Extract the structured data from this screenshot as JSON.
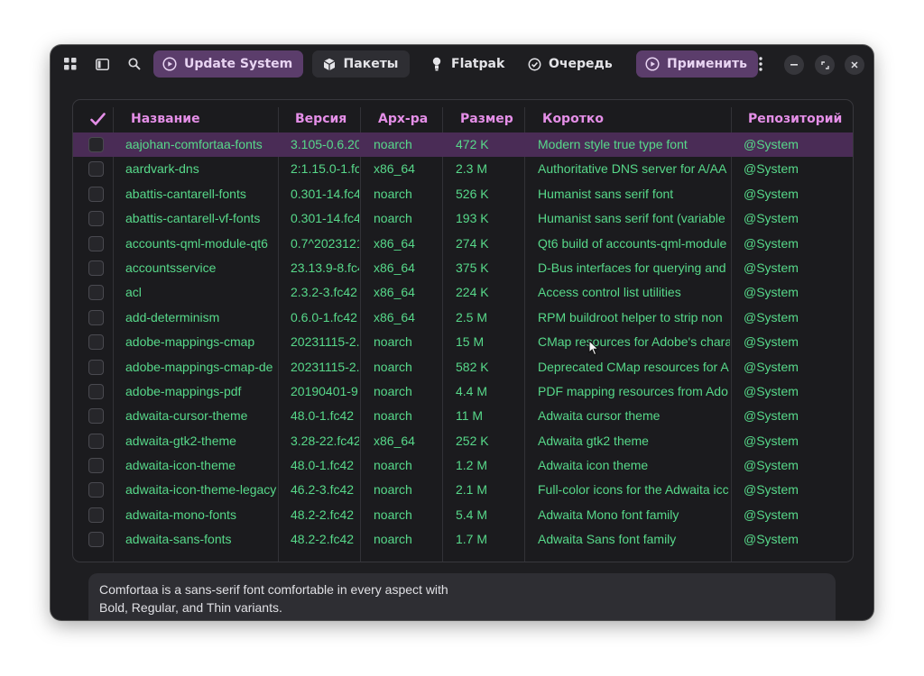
{
  "header": {
    "update_label": "Update System",
    "tabs": [
      {
        "label": "Пакеты",
        "icon": "package-icon",
        "active": true
      },
      {
        "label": "Flatpak",
        "icon": "flatpak-icon",
        "active": false
      },
      {
        "label": "Очередь",
        "icon": "check-circle-icon",
        "active": false
      }
    ],
    "apply_label": "Применить"
  },
  "table": {
    "columns": [
      "Название",
      "Версия",
      "Арх-ра",
      "Размер",
      "Коротко",
      "Репозиторий"
    ],
    "rows": [
      {
        "name": "aajohan-comfortaa-fonts",
        "version": "3.105-0.6.20",
        "arch": "noarch",
        "size": "472 K",
        "summary": "Modern style true type font",
        "repo": "@System",
        "selected": true
      },
      {
        "name": "aardvark-dns",
        "version": "2:1.15.0-1.fc",
        "arch": "x86_64",
        "size": "2.3 M",
        "summary": "Authoritative DNS server for A/AA",
        "repo": "@System"
      },
      {
        "name": "abattis-cantarell-fonts",
        "version": "0.301-14.fc4",
        "arch": "noarch",
        "size": "526 K",
        "summary": "Humanist sans serif font",
        "repo": "@System"
      },
      {
        "name": "abattis-cantarell-vf-fonts",
        "version": "0.301-14.fc4",
        "arch": "noarch",
        "size": "193 K",
        "summary": "Humanist sans serif font (variable",
        "repo": "@System"
      },
      {
        "name": "accounts-qml-module-qt6",
        "version": "0.7^2023121",
        "arch": "x86_64",
        "size": "274 K",
        "summary": "Qt6 build of accounts-qml-module",
        "repo": "@System"
      },
      {
        "name": "accountsservice",
        "version": "23.13.9-8.fc4",
        "arch": "x86_64",
        "size": "375 K",
        "summary": "D-Bus interfaces for querying and",
        "repo": "@System"
      },
      {
        "name": "acl",
        "version": "2.3.2-3.fc42",
        "arch": "x86_64",
        "size": "224 K",
        "summary": "Access control list utilities",
        "repo": "@System"
      },
      {
        "name": "add-determinism",
        "version": "0.6.0-1.fc42",
        "arch": "x86_64",
        "size": "2.5 M",
        "summary": "RPM buildroot helper to strip non",
        "repo": "@System"
      },
      {
        "name": "adobe-mappings-cmap",
        "version": "20231115-2.",
        "arch": "noarch",
        "size": "15 M",
        "summary": "CMap resources for Adobe's chara",
        "repo": "@System"
      },
      {
        "name": "adobe-mappings-cmap-de",
        "version": "20231115-2.",
        "arch": "noarch",
        "size": "582 K",
        "summary": "Deprecated CMap resources for A",
        "repo": "@System"
      },
      {
        "name": "adobe-mappings-pdf",
        "version": "20190401-9.",
        "arch": "noarch",
        "size": "4.4 M",
        "summary": "PDF mapping resources from Ado",
        "repo": "@System"
      },
      {
        "name": "adwaita-cursor-theme",
        "version": "48.0-1.fc42",
        "arch": "noarch",
        "size": "11 M",
        "summary": "Adwaita cursor theme",
        "repo": "@System"
      },
      {
        "name": "adwaita-gtk2-theme",
        "version": "3.28-22.fc42",
        "arch": "x86_64",
        "size": "252 K",
        "summary": "Adwaita gtk2 theme",
        "repo": "@System"
      },
      {
        "name": "adwaita-icon-theme",
        "version": "48.0-1.fc42",
        "arch": "noarch",
        "size": "1.2 M",
        "summary": "Adwaita icon theme",
        "repo": "@System"
      },
      {
        "name": "adwaita-icon-theme-legacy",
        "version": "46.2-3.fc42",
        "arch": "noarch",
        "size": "2.1 M",
        "summary": "Full-color icons for the Adwaita icc",
        "repo": "@System"
      },
      {
        "name": "adwaita-mono-fonts",
        "version": "48.2-2.fc42",
        "arch": "noarch",
        "size": "5.4 M",
        "summary": "Adwaita Mono font family",
        "repo": "@System"
      },
      {
        "name": "adwaita-sans-fonts",
        "version": "48.2-2.fc42",
        "arch": "noarch",
        "size": "1.7 M",
        "summary": "Adwaita Sans font family",
        "repo": "@System"
      }
    ]
  },
  "description": "Comfortaa is a sans-serif font comfortable in every aspect with Bold, Regular, and Thin variants.",
  "colors": {
    "accent": "#e58fe8",
    "text_green": "#57d98a",
    "selected_row": "#4a2c56",
    "purple_button": "#5b3d6b"
  }
}
